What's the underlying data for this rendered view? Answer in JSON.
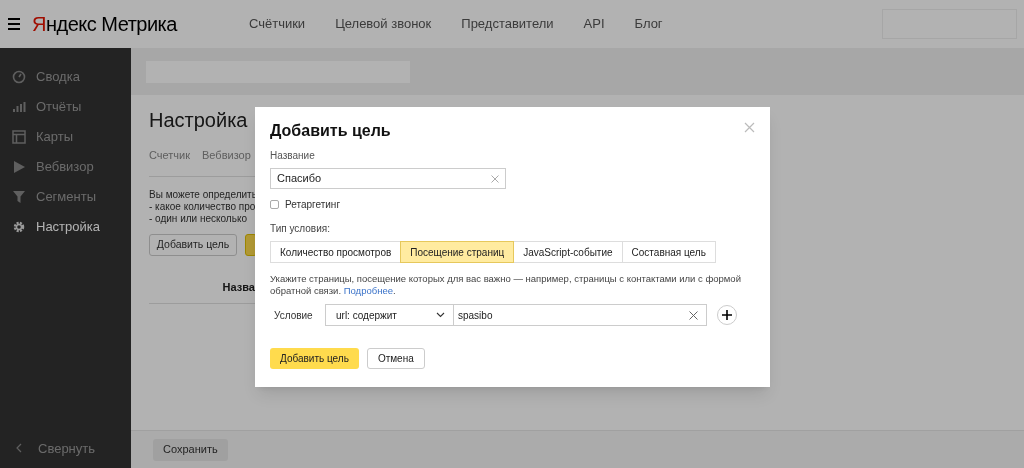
{
  "header": {
    "logo": {
      "brand": "Яндекс",
      "product": "Метрика"
    },
    "nav": [
      "Счётчики",
      "Целевой звонок",
      "Представители",
      "API",
      "Блог"
    ]
  },
  "sidebar": {
    "items": [
      {
        "label": "Сводка",
        "selected": false
      },
      {
        "label": "Отчёты",
        "selected": false
      },
      {
        "label": "Карты",
        "selected": false
      },
      {
        "label": "Вебвизор",
        "selected": false
      },
      {
        "label": "Сегменты",
        "selected": false
      },
      {
        "label": "Настройка",
        "selected": true
      }
    ],
    "collapse": "Свернуть"
  },
  "page": {
    "title": "Настройка",
    "tabs": [
      "Счетчик",
      "Вебвизор"
    ],
    "intro": [
      "Вы можете определить",
      "- какое количество про",
      "- один или несколько"
    ],
    "add_button": "Добавить цель",
    "column_1": "Назва",
    "save_button": "Сохранить"
  },
  "dialog": {
    "title": "Добавить цель",
    "name_label": "Название",
    "name_value": "Спасибо",
    "retargeting": {
      "label": "Ретаргетинг",
      "checked": false
    },
    "type_label": "Тип условия:",
    "types": [
      {
        "label": "Количество просмотров",
        "selected": false
      },
      {
        "label": "Посещение страниц",
        "selected": true
      },
      {
        "label": "JavaScript-событие",
        "selected": false
      },
      {
        "label": "Составная цель",
        "selected": false
      }
    ],
    "description": "Укажите страницы, посещение которых для вас важно — например, страницы с контактами или с формой обратной связи.",
    "more_link": "Подробнее",
    "after_link": ".",
    "condition_label": "Условие",
    "condition_operator": "url: содержит",
    "condition_value": "spasibo",
    "submit": "Добавить цель",
    "cancel": "Отмена"
  }
}
